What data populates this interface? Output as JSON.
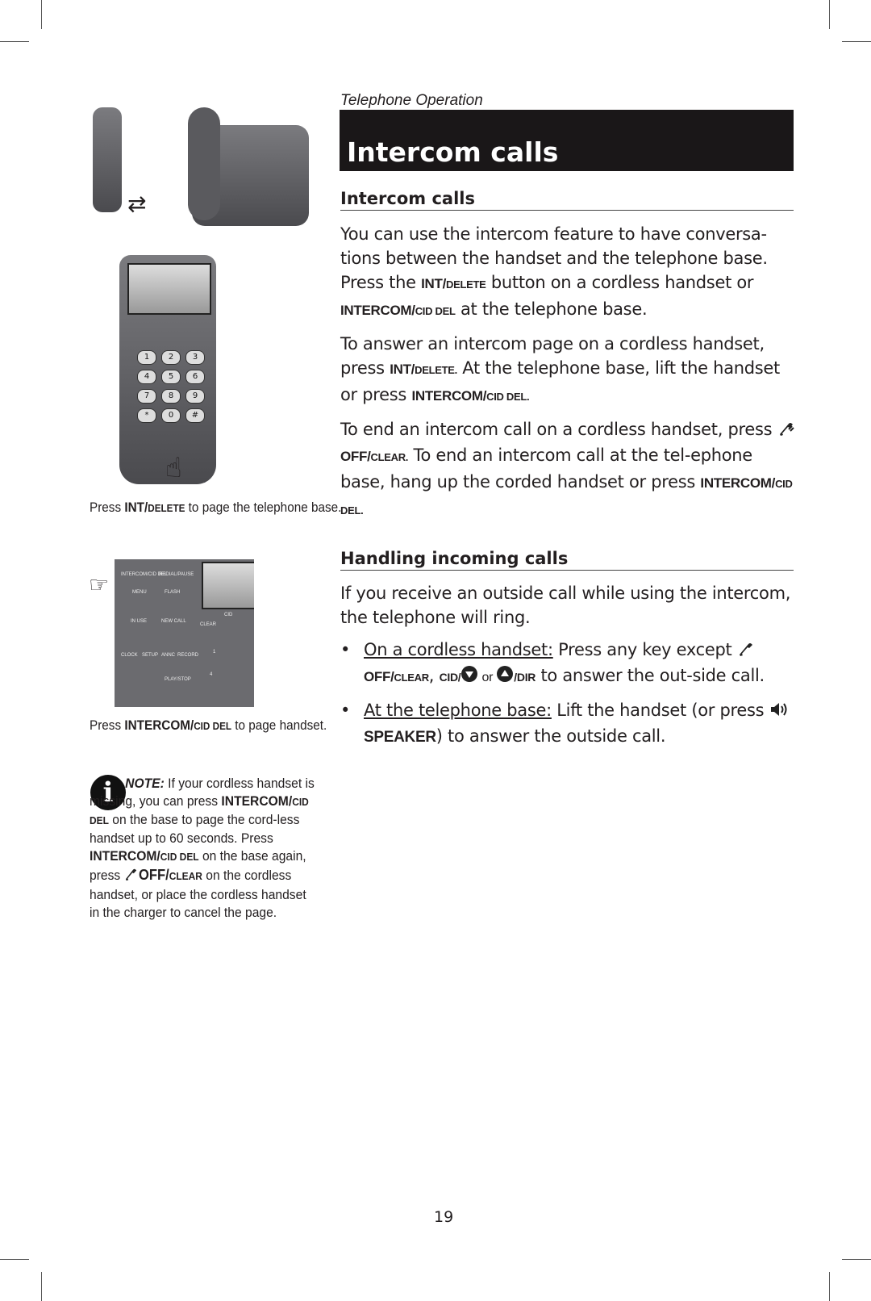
{
  "header": {
    "section": "Telephone Operation",
    "title": "Intercom calls"
  },
  "intercom": {
    "heading": "Intercom calls",
    "p1": {
      "a": "You can use the intercom feature to have conversa-tions between the handset and the telephone base. Press the ",
      "k1": "INT/",
      "k1s": "DELETE",
      "b": " button on a cordless handset or ",
      "k2": "INTERCOM/",
      "k2s": "CID DEL",
      "c": " at the telephone base."
    },
    "p2": {
      "a": "To answer an intercom page on a cordless handset, press ",
      "k1": "INT/",
      "k1s": "DELETE.",
      "b": " At the telephone base, lift the handset or press ",
      "k2": "INTERCOM/",
      "k2s": "CID DEL."
    },
    "p3": {
      "k1": "OFF/",
      "k1s": "CLEAR.",
      "a": "To end an intercom call on a cordless handset, press ",
      "b": " To end an intercom call at the tel-ephone base, hang up the corded handset or press ",
      "k2": "INTERCOM/",
      "k2s": "CID DEL."
    }
  },
  "incoming": {
    "heading": "Handling incoming calls",
    "p1": "If you receive an outside call while using the intercom, the telephone will ring.",
    "bullets": [
      {
        "dot": "•",
        "lead": "On a cordless handset:",
        "a": " Press any key except ",
        "k1": "OFF/",
        "k1s": "CLEAR",
        "sep": ", ",
        "k2": "CID/",
        "or": " or ",
        "k3": "/DIR",
        "b": " to answer the out-side call."
      },
      {
        "dot": "•",
        "lead": "At the telephone base:",
        "a": " Lift the handset (or press ",
        "k1": "SPEAKER",
        "b": ") to answer the outside call."
      }
    ]
  },
  "left": {
    "caption1": {
      "a": "Press ",
      "k": "INT/",
      "ks": "DELETE",
      "b": " to page the telephone base."
    },
    "caption2": {
      "a": "Press ",
      "k": "INTERCOM/",
      "ks": "CID DEL",
      "b": " to page handset."
    },
    "note": {
      "label": "NOTE:",
      "a": " If your cordless handset is missing, you can press ",
      "k1": "INTERCOM/",
      "k1s": "CID DEL",
      "b": " on the base to page the cord-less handset up to 60 seconds. Press ",
      "k2": "INTERCOM/",
      "k2s": "CID DEL",
      "c": " on the base again, press ",
      "k3": "OFF/",
      "k3s": "CLEAR",
      "d": " on the cordless handset, or place the cordless handset in the charger to cancel the page."
    },
    "handset_keys": [
      "1",
      "2",
      "3",
      "4",
      "5",
      "6",
      "7",
      "8",
      "9",
      "*",
      "0",
      "#"
    ],
    "base_labels": [
      "INTERCOM/CID DEL",
      "REDIAL/PAUSE",
      "MENU",
      "FLASH",
      "IN USE",
      "NEW CALL",
      "CLEAR",
      "CID",
      "CLOCK",
      "SETUP",
      "ANNC",
      "RECORD",
      "PLAY/STOP",
      "1",
      "4"
    ]
  },
  "icons": {
    "phone": "phone-off-icon",
    "down": "down-arrow-icon",
    "up": "up-arrow-icon",
    "speaker": "speaker-icon",
    "info": "info-icon"
  },
  "footer": {
    "page_number": "19"
  }
}
